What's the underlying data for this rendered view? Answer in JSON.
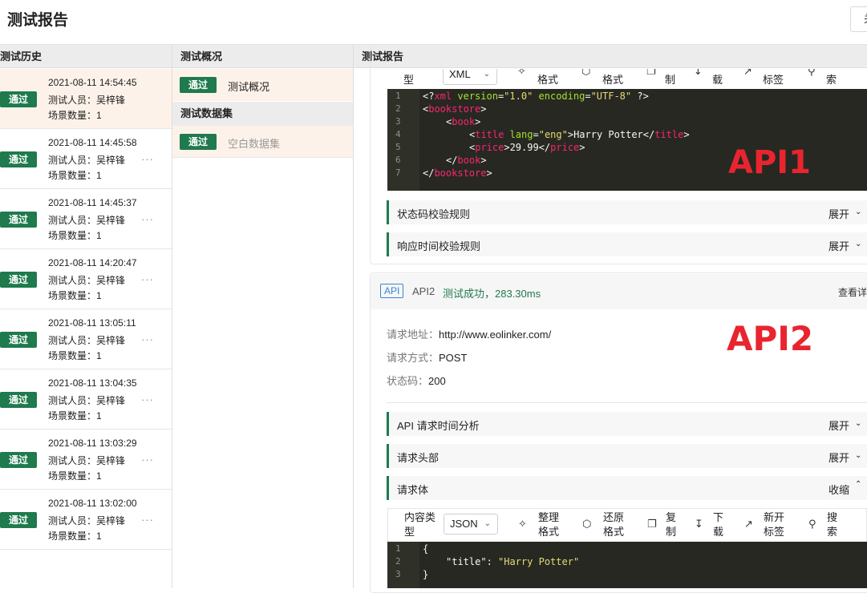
{
  "page": {
    "title": "测试报告",
    "close_label": "关"
  },
  "columns": {
    "history": "测试历史",
    "overview": "测试概况",
    "report": "测试报告"
  },
  "history": {
    "items": [
      {
        "status": "通过",
        "time": "2021-08-11 14:54:45",
        "tester": "测试人员：吴梓锋",
        "scenes": "场景数量：1",
        "more": ""
      },
      {
        "status": "通过",
        "time": "2021-08-11 14:45:58",
        "tester": "测试人员：吴梓锋",
        "scenes": "场景数量：1",
        "more": "···"
      },
      {
        "status": "通过",
        "time": "2021-08-11 14:45:37",
        "tester": "测试人员：吴梓锋",
        "scenes": "场景数量：1",
        "more": "···"
      },
      {
        "status": "通过",
        "time": "2021-08-11 14:20:47",
        "tester": "测试人员：吴梓锋",
        "scenes": "场景数量：1",
        "more": "···"
      },
      {
        "status": "通过",
        "time": "2021-08-11 13:05:11",
        "tester": "测试人员：吴梓锋",
        "scenes": "场景数量：1",
        "more": "···"
      },
      {
        "status": "通过",
        "time": "2021-08-11 13:04:35",
        "tester": "测试人员：吴梓锋",
        "scenes": "场景数量：1",
        "more": "···"
      },
      {
        "status": "通过",
        "time": "2021-08-11 13:03:29",
        "tester": "测试人员：吴梓锋",
        "scenes": "场景数量：1",
        "more": "···"
      },
      {
        "status": "通过",
        "time": "2021-08-11 13:02:00",
        "tester": "测试人员：吴梓锋",
        "scenes": "场景数量：1",
        "more": "···"
      }
    ]
  },
  "overview": {
    "row1": {
      "status": "通过",
      "label": "测试概况"
    },
    "dataset_header": "测试数据集",
    "row2": {
      "status": "通过",
      "label": "空白数据集"
    }
  },
  "report": {
    "toolbar1": {
      "type_label": "型",
      "format_value": "XML",
      "beautify": "格式",
      "restore": "格式",
      "copy": "制",
      "download": "载",
      "newtab": "标签",
      "search": "索"
    },
    "xml_code": {
      "line_numbers": [
        "1",
        "2",
        "3",
        "4",
        "5",
        "6",
        "7"
      ],
      "l1_a": "<?",
      "l1_b": "xml",
      "l1_c": " version",
      "l1_d": "=",
      "l1_e": "\"1.0\"",
      "l1_f": " encoding",
      "l1_g": "=",
      "l1_h": "\"UTF-8\"",
      "l1_i": " ?>",
      "l2_a": "<",
      "l2_b": "bookstore",
      "l2_c": ">",
      "l3_a": "<",
      "l3_b": "book",
      "l3_c": ">",
      "l4_a": "<",
      "l4_b": "title",
      "l4_c": " lang",
      "l4_d": "=",
      "l4_e": "\"eng\"",
      "l4_f": ">Harry Potter</",
      "l4_g": "title",
      "l4_h": ">",
      "l5_a": "<",
      "l5_b": "price",
      "l5_c": ">29.99</",
      "l5_d": "price",
      "l5_e": ">",
      "l6_a": "</",
      "l6_b": "book",
      "l6_c": ">",
      "l7_a": "</",
      "l7_b": "bookstore",
      "l7_c": ">"
    },
    "annotation_api1": "API1",
    "status_rule": {
      "label": "状态码校验规则",
      "action": "展开"
    },
    "time_rule": {
      "label": "响应时间校验规则",
      "action": "展开"
    },
    "api2": {
      "tag": "API",
      "name": "API2",
      "result": "测试成功，283.30ms",
      "view_detail": "查看详",
      "annotation": "API2",
      "url_key": "请求地址：",
      "url_value": "http://www.eolinker.com/",
      "method_key": "请求方式：",
      "method_value": "POST",
      "code_key": "状态码：",
      "code_value": "200",
      "timing": {
        "label": "API 请求时间分析",
        "action": "展开"
      },
      "headers": {
        "label": "请求头部",
        "action": "展开"
      },
      "body": {
        "label": "请求体",
        "action": "收缩"
      },
      "toolbar2": {
        "type_label_1": "内容类",
        "type_label_2": "型",
        "format_value": "JSON",
        "beautify_1": "整理",
        "beautify_2": "格式",
        "restore_1": "还原",
        "restore_2": "格式",
        "copy_1": "复",
        "copy_2": "制",
        "download_1": "下",
        "download_2": "载",
        "newtab_1": "新开",
        "newtab_2": "标签",
        "search_1": "搜",
        "search_2": "索"
      },
      "json_code": {
        "line_numbers": [
          "1",
          "2",
          "3"
        ],
        "l1": "{",
        "l2_key": "\"title\"",
        "l2_colon": ": ",
        "l2_val": "\"Harry Potter\"",
        "l3": "}"
      }
    }
  },
  "colors": {
    "pass_green": "#1f7a4d",
    "active_row": "#fdf2e9",
    "annotation_red": "#e8252f",
    "api_blue": "#3a83d6"
  }
}
